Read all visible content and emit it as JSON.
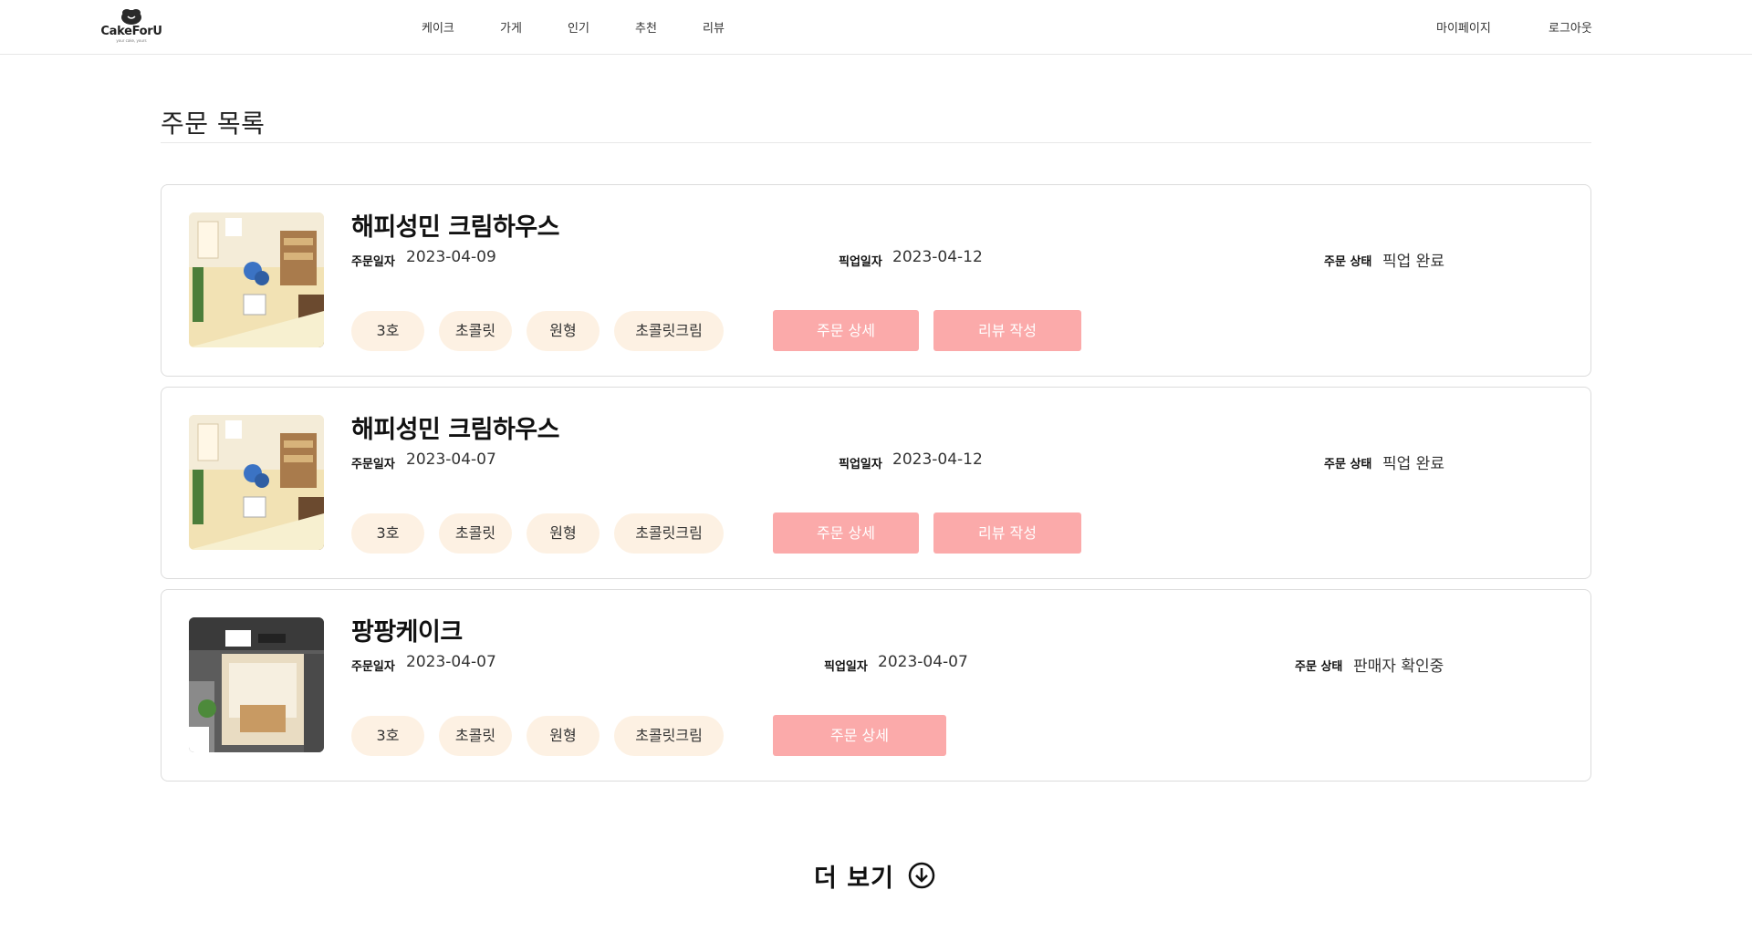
{
  "header": {
    "logo_text": "CakeForU",
    "logo_sub": "your cake, yours",
    "nav": [
      "케이크",
      "가게",
      "인기",
      "추천",
      "리뷰"
    ],
    "mypage": "마이페이지",
    "logout": "로그아웃"
  },
  "page": {
    "title": "주문 목록"
  },
  "labels": {
    "order_date": "주문일자",
    "pickup_date": "픽업일자",
    "status": "주문 상태",
    "order_detail": "주문 상세",
    "write_review": "리뷰 작성"
  },
  "orders": [
    {
      "store": "해피성민 크림하우스",
      "order_date": "2023-04-09",
      "pickup_date": "2023-04-12",
      "status": "픽업 완료",
      "options": [
        "3호",
        "초콜릿",
        "원형",
        "초콜릿크림"
      ],
      "thumb_icon": "store-interior-photo"
    },
    {
      "store": "해피성민 크림하우스",
      "order_date": "2023-04-07",
      "pickup_date": "2023-04-12",
      "status": "픽업 완료",
      "options": [
        "3호",
        "초콜릿",
        "원형",
        "초콜릿크림"
      ],
      "thumb_icon": "store-interior-photo"
    },
    {
      "store": "팡팡케이크",
      "order_date": "2023-04-07",
      "pickup_date": "2023-04-07",
      "status": "판매자 확인중",
      "options": [
        "3호",
        "초콜릿",
        "원형",
        "초콜릿크림"
      ],
      "thumb_icon": "storefront-photo"
    }
  ],
  "more": {
    "label": "더 보기",
    "icon": "arrow-down-circle-icon"
  },
  "colors": {
    "button_bg": "#fbaaaa",
    "chip_bg": "#fdf1e3",
    "border": "#dcdcdc"
  }
}
